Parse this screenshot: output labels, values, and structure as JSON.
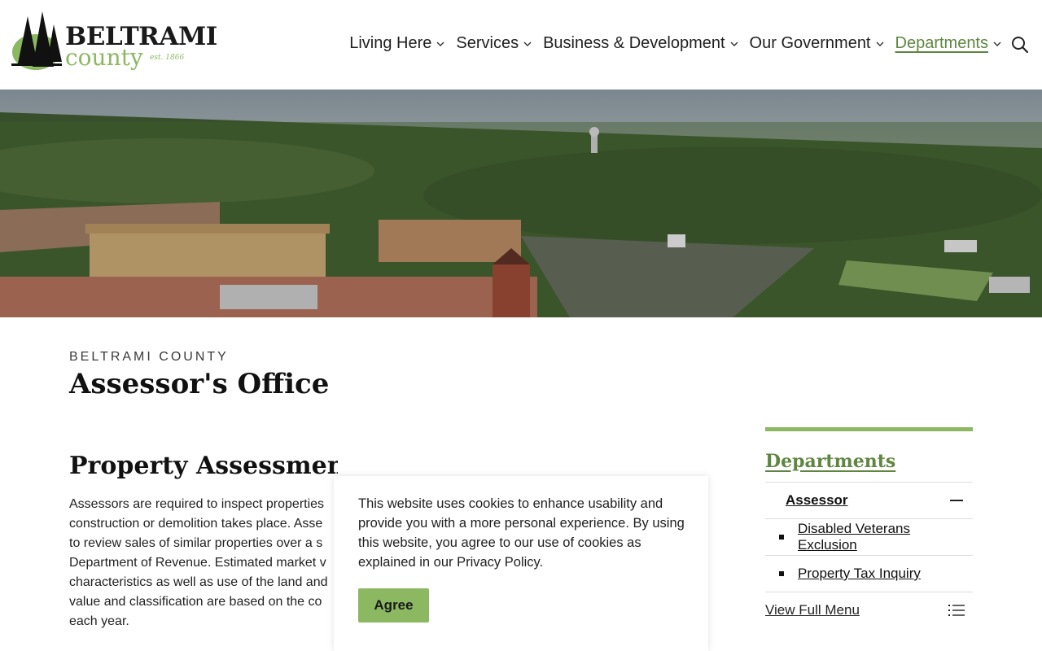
{
  "logo": {
    "name_line1": "BELTRAMI",
    "name_line2": "county",
    "established": "est. 1866"
  },
  "nav": {
    "items": [
      {
        "label": "Living Here"
      },
      {
        "label": "Services"
      },
      {
        "label": "Business & Development"
      },
      {
        "label": "Our Government"
      },
      {
        "label": "Departments",
        "active": true
      }
    ],
    "search_icon": "magnifier-icon"
  },
  "hero": {
    "icon": "aerial-town-photo"
  },
  "page": {
    "eyebrow": "BELTRAMI COUNTY",
    "title": "Assessor's Office",
    "section_title": "Property Assessment",
    "body_lines": [
      "Assessors are required to inspect properties",
      "construction or demolition takes place. Asse",
      "to review sales of similar properties over a s",
      "Department of Revenue. Estimated market v",
      "characteristics as well as use of the land and",
      "value and classification are based on the co",
      "each year."
    ]
  },
  "sidebar": {
    "title": "Departments",
    "parent": {
      "label": "Assessor",
      "icon": "minus-icon"
    },
    "children": [
      {
        "label": "Disabled Veterans Exclusion"
      },
      {
        "label": "Property Tax Inquiry"
      }
    ],
    "full_menu_label": "View Full Menu",
    "full_menu_icon": "list-icon"
  },
  "cookie": {
    "text": "This website uses cookies to enhance usability and provide you with a more personal experience. By using this website, you agree to our use of cookies as explained in our Privacy Policy.",
    "agree_label": "Agree"
  },
  "colors": {
    "accent_green": "#8cb862",
    "dark_green": "#5e8640"
  }
}
